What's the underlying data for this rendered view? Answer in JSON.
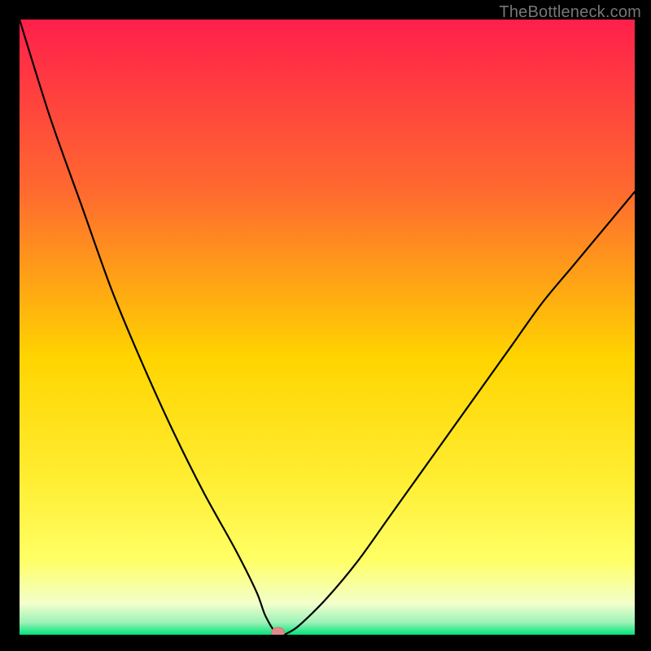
{
  "watermark": "TheBottleneck.com",
  "chart_data": {
    "type": "line",
    "title": "",
    "xlabel": "",
    "ylabel": "",
    "xlim": [
      0,
      100
    ],
    "ylim": [
      0,
      100
    ],
    "grid": false,
    "colors": {
      "gradient_top": "#ff1f4b",
      "gradient_mid_upper": "#ff8a2a",
      "gradient_mid": "#ffd400",
      "gradient_lower": "#ffff66",
      "gradient_near_bottom": "#f2ffcc",
      "gradient_bottom": "#00e47a",
      "curve": "#000000",
      "marker_fill": "#e08a8a",
      "marker_stroke": "#c87878",
      "frame": "#000000"
    },
    "annotations": [
      {
        "type": "marker",
        "x": 42,
        "y": 0,
        "label": ""
      }
    ],
    "series": [
      {
        "name": "curve",
        "x": [
          0,
          5,
          10,
          15,
          20,
          25,
          30,
          35,
          38.5,
          40,
          42,
          44,
          46,
          50,
          55,
          60,
          65,
          70,
          75,
          80,
          85,
          90,
          95,
          100
        ],
        "y": [
          100,
          84,
          70,
          56,
          44,
          33,
          23,
          14,
          7,
          3,
          0,
          0.5,
          2,
          6,
          12,
          19,
          26,
          33,
          40,
          47,
          54,
          60,
          66,
          72
        ]
      }
    ]
  }
}
